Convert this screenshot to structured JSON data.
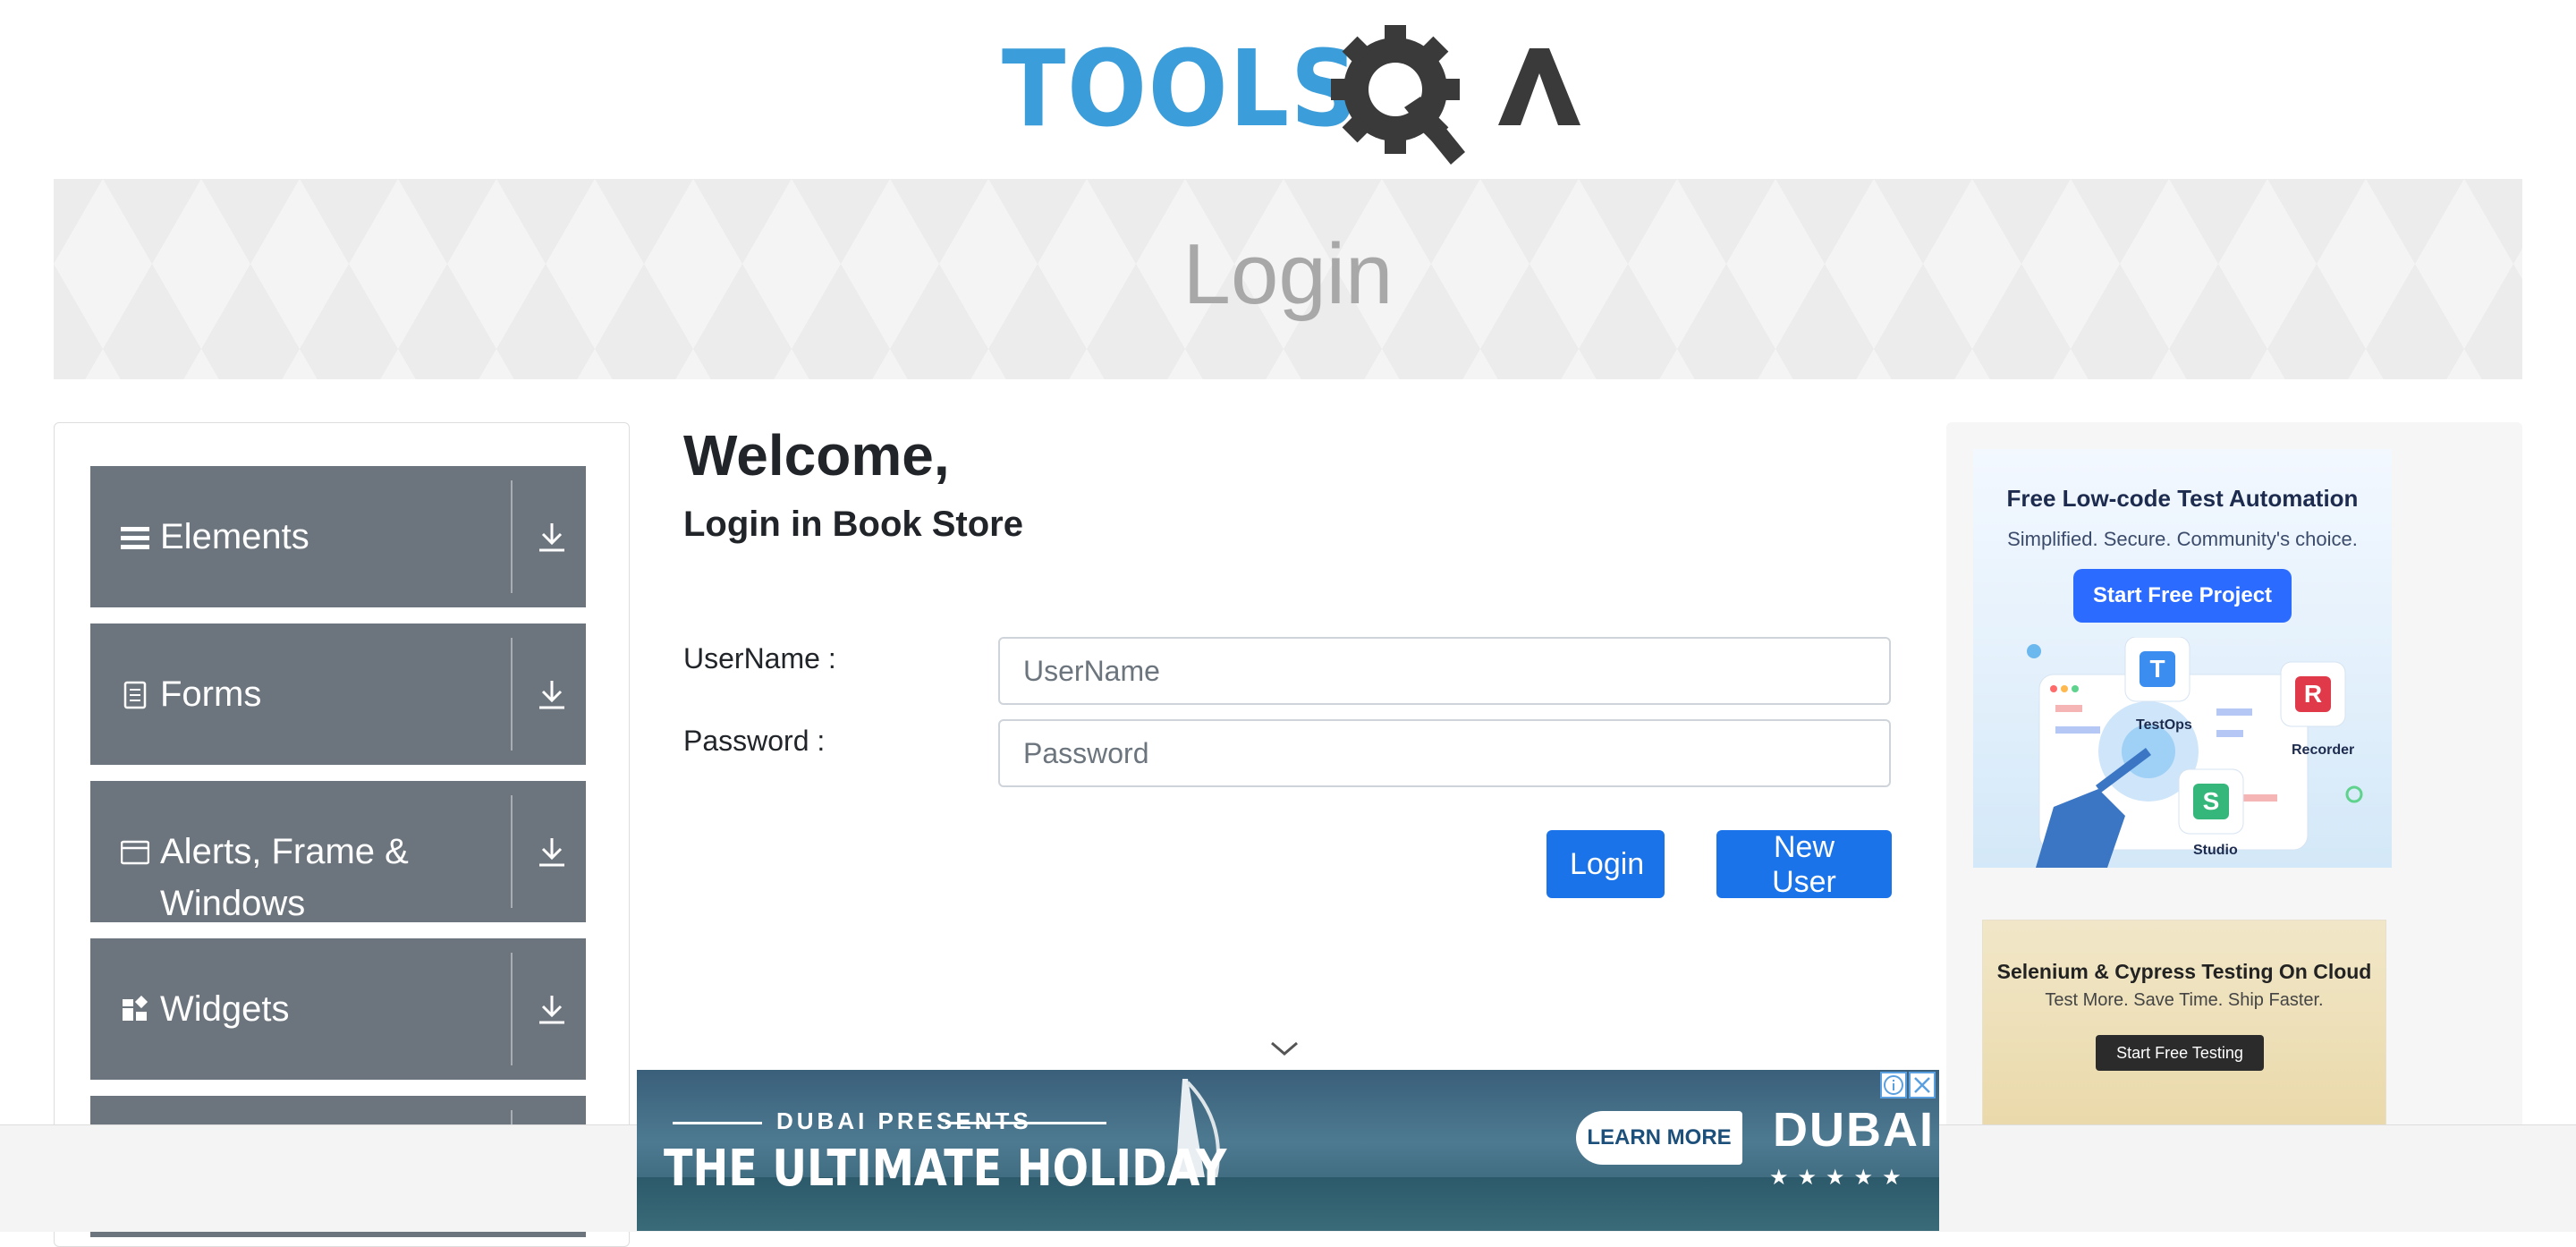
{
  "logo": {
    "text": "TOOLSQA"
  },
  "page_title": "Login",
  "sidebar": {
    "groups": [
      {
        "label": "Elements",
        "icon": "menu-icon"
      },
      {
        "label": "Forms",
        "icon": "document-icon"
      },
      {
        "label": "Alerts, Frame & Windows",
        "icon": "window-icon"
      },
      {
        "label": "Widgets",
        "icon": "widgets-icon"
      }
    ]
  },
  "main": {
    "heading": "Welcome,",
    "subheading": "Login in Book Store",
    "username_label": "UserName :",
    "username_placeholder": "UserName",
    "password_label": "Password :",
    "password_placeholder": "Password",
    "login_button": "Login",
    "new_user_button": "New User"
  },
  "ads": {
    "ad1": {
      "title": "Free Low-code Test Automation",
      "subtitle": "Simplified. Secure. Community's choice.",
      "cta": "Start Free Project",
      "labels": [
        "TestOps",
        "Recorder",
        "Studio"
      ]
    },
    "ad2": {
      "title": "Selenium & Cypress Testing On Cloud",
      "subtitle": "Test More. Save Time. Ship Faster.",
      "cta": "Start Free Testing"
    },
    "bottom": {
      "presents": "DUBAI PRESENTS",
      "headline": "THE ULTIMATE HOLIDAY",
      "cta": "LEARN MORE",
      "brand": "DUBAI",
      "stars": "★★★★★"
    }
  },
  "colors": {
    "logo_blue": "#3b9dd9",
    "logo_dark": "#3a3a3a",
    "sidebar_gray": "#6c757d",
    "primary_button": "#1a73e8"
  }
}
